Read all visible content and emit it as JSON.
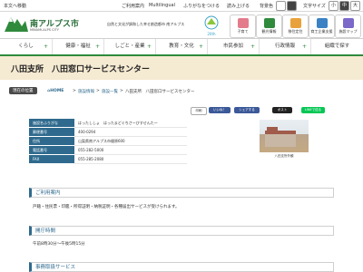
{
  "topbar": {
    "skip": "本文へ移動",
    "guide": "ご利用案内",
    "multilingual": "Multilingual",
    "furigana": "ふりがなをつける",
    "readaloud": "読み上げる",
    "bg_color": "背景色",
    "font_size": "文字サイズ",
    "sizes": [
      "小",
      "中",
      "大"
    ]
  },
  "header": {
    "logo_name": "南アルプス市",
    "logo_sub": "MINAMI-ALPS CITY",
    "tagline": "自然と文化が調和した幸せ創造都市 南アルプス",
    "quick_links": [
      {
        "label": "子育て",
        "icon": "family-icon",
        "color": "#e37b8b"
      },
      {
        "label": "観光情報",
        "icon": "tourism-icon",
        "color": "#2f8a3c"
      },
      {
        "label": "移住定住",
        "icon": "house-icon",
        "color": "#e9a23b"
      },
      {
        "label": "商工企業支援",
        "icon": "business-icon",
        "color": "#3a82c4"
      },
      {
        "label": "施設マップ",
        "icon": "map-icon",
        "color": "#7b68c9"
      }
    ]
  },
  "nav": [
    "くらし",
    "健康・福祉",
    "しごと・産業",
    "教育・文化",
    "市民参加",
    "行政情報",
    "組織で探す"
  ],
  "page_title": "八田支所　八田窓口サービスセンター",
  "breadcrumb": {
    "label": "現在の位置",
    "items": [
      "HOME",
      "施設情報",
      "施設一覧",
      "八田支所　八田窓口サービスセンター"
    ]
  },
  "share": {
    "print": "印刷",
    "like": "いいね！",
    "share": "シェアする",
    "post": "ポスト",
    "line": "LINEで送る"
  },
  "info": [
    {
      "key": "施設名ふりがな",
      "value": "はったししょ　はったまどぐちさーびすせんたー"
    },
    {
      "key": "郵便番号",
      "value": "400-0294"
    },
    {
      "key": "住所",
      "value": "山梨県南アルプス市榎原600"
    },
    {
      "key": "電話番号",
      "value": "055-282-5000"
    },
    {
      "key": "FAX",
      "value": "055-285-2080"
    }
  ],
  "photo_caption": "八田支所外観",
  "sections": [
    {
      "title": "ご利用案内",
      "body": "戸籍・住民票・印鑑・所得証明・納税証明・各種届出サービスが受けられます。"
    },
    {
      "title": "開庁時間",
      "body": "午前8時30分～午後5時15分"
    },
    {
      "title": "事務取扱サービス",
      "body": ""
    }
  ]
}
